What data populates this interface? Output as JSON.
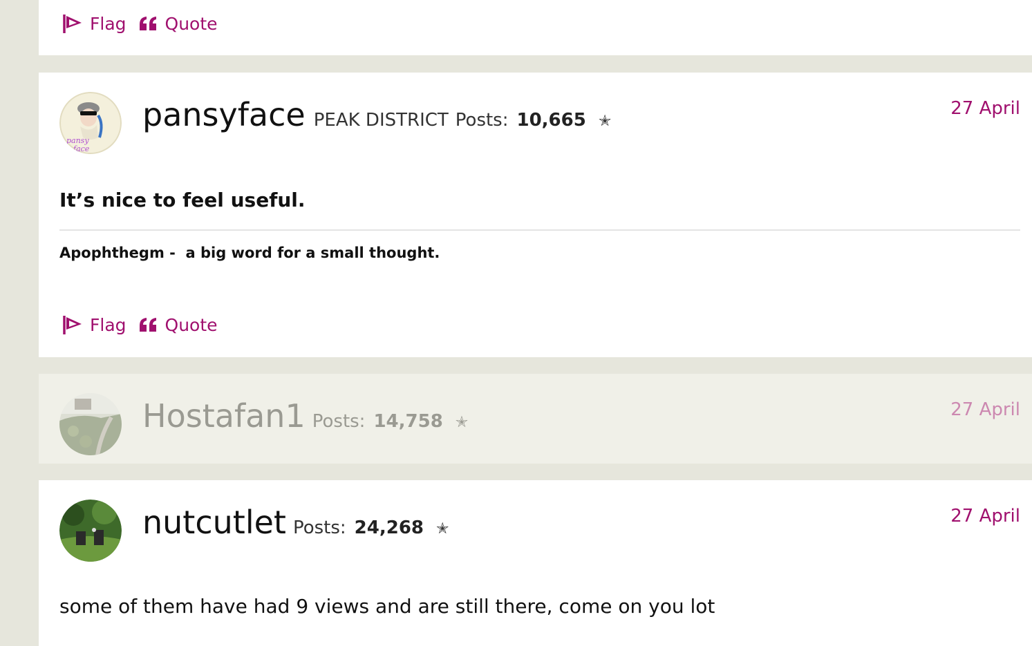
{
  "actions": {
    "flag_label": "Flag",
    "quote_label": "Quote"
  },
  "posts": [
    {
      "username": "pansyface",
      "location": "PEAK DISTRICT",
      "posts_label": "Posts:",
      "posts_count": "10,665",
      "rank_icon": "star-icon",
      "date": "27 April",
      "body": "It’s nice to feel useful.",
      "signature": "Apophthegm -  a big word for a small thought."
    },
    {
      "username": "Hostafan1",
      "posts_label": "Posts:",
      "posts_count": "14,758",
      "rank_icon": "star-icon",
      "date": "27 April"
    },
    {
      "username": "nutcutlet",
      "posts_label": "Posts:",
      "posts_count": "24,268",
      "rank_icon": "star-icon",
      "date": "27 April",
      "body": "some of them have had 9 views and are still there, come on you lot"
    }
  ],
  "colors": {
    "accent": "#a0106e",
    "page_bg": "#e6e6dc",
    "faded_card": "#f0f0e8"
  }
}
